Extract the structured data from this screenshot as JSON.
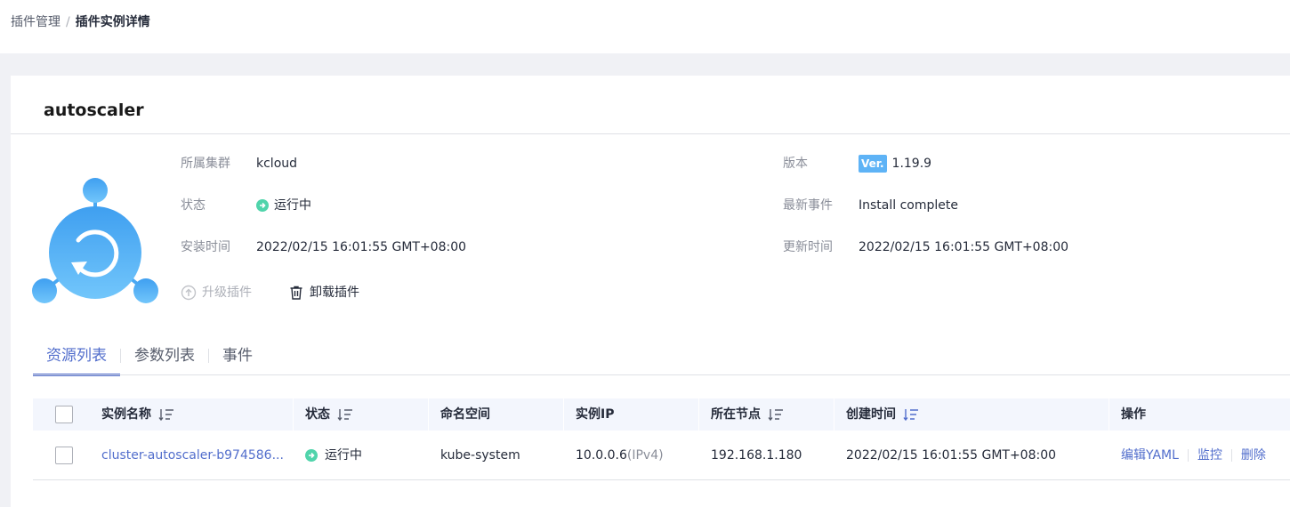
{
  "breadcrumb": {
    "parent": "插件管理",
    "separator": "/",
    "current": "插件实例详情"
  },
  "addon": {
    "name": "autoscaler",
    "info_left": [
      {
        "label": "所属集群",
        "value": "kcloud"
      },
      {
        "label": "状态",
        "value": "运行中"
      },
      {
        "label": "安装时间",
        "value": "2022/02/15 16:01:55 GMT+08:00"
      }
    ],
    "info_right": [
      {
        "label": "版本",
        "badge": "Ver.",
        "value": "1.19.9"
      },
      {
        "label": "最新事件",
        "value": "Install complete"
      },
      {
        "label": "更新时间",
        "value": "2022/02/15 16:01:55 GMT+08:00"
      }
    ],
    "actions": {
      "upgrade": "升级插件",
      "uninstall": "卸载插件"
    },
    "colors": {
      "accent": "#526ecc",
      "running": "#50d4ab",
      "logo": "#3f9ff0",
      "badge": "#5eb3f6"
    }
  },
  "tabs": [
    "资源列表",
    "参数列表",
    "事件"
  ],
  "table": {
    "headers": [
      "实例名称",
      "状态",
      "命名空间",
      "实例IP",
      "所在节点",
      "创建时间",
      "操作"
    ],
    "rows": [
      {
        "name": "cluster-autoscaler-b974586...",
        "status": "运行中",
        "namespace": "kube-system",
        "ip": "10.0.0.6",
        "ip_type": "(IPv4)",
        "node": "192.168.1.180",
        "created": "2022/02/15 16:01:55 GMT+08:00",
        "ops": [
          "编辑YAML",
          "监控",
          "删除"
        ]
      }
    ]
  }
}
